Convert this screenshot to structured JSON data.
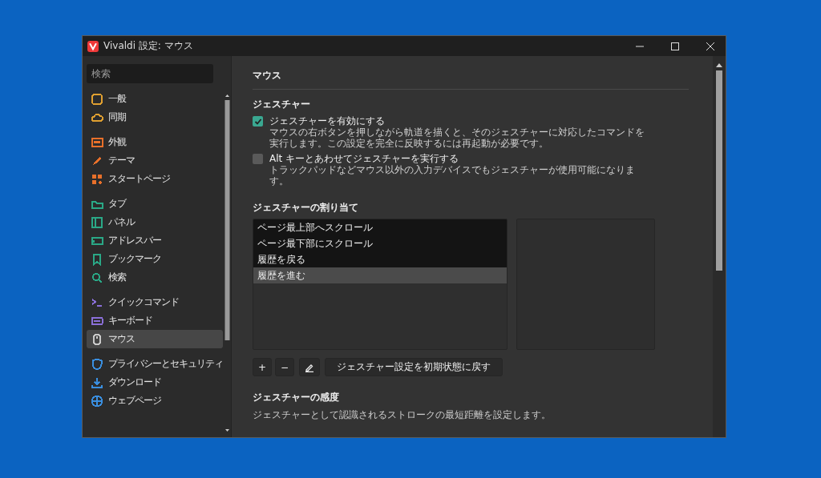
{
  "window": {
    "title": "Vivaldi 設定: マウス"
  },
  "sidebar": {
    "search": {
      "placeholder": "検索"
    },
    "groups": [
      [
        {
          "label": "一般",
          "color": "#e0a030",
          "selected": false
        },
        {
          "label": "同期",
          "color": "#e0a030",
          "selected": false
        }
      ],
      [
        {
          "label": "外観",
          "color": "#e8702a",
          "selected": false
        },
        {
          "label": "テーマ",
          "color": "#e8702a",
          "selected": false
        },
        {
          "label": "スタートページ",
          "color": "#e8702a",
          "selected": false
        }
      ],
      [
        {
          "label": "タブ",
          "color": "#2aa886",
          "selected": false
        },
        {
          "label": "パネル",
          "color": "#2aa886",
          "selected": false
        },
        {
          "label": "アドレスバー",
          "color": "#2aa886",
          "selected": false
        },
        {
          "label": "ブックマーク",
          "color": "#2aa886",
          "selected": false
        },
        {
          "label": "検索",
          "color": "#2aa886",
          "selected": false
        }
      ],
      [
        {
          "label": "クイックコマンド",
          "color": "#8a6fd8",
          "selected": false
        },
        {
          "label": "キーボード",
          "color": "#8a6fd8",
          "selected": false
        },
        {
          "label": "マウス",
          "color": "#c8c8c8",
          "selected": true
        }
      ],
      [
        {
          "label": "プライバシーとセキュリティ",
          "color": "#3a8fe0",
          "selected": false
        },
        {
          "label": "ダウンロード",
          "color": "#3a8fe0",
          "selected": false
        },
        {
          "label": "ウェブページ",
          "color": "#3a8fe0",
          "selected": false
        }
      ]
    ]
  },
  "page": {
    "title": "マウス",
    "gestures": {
      "title": "ジェスチャー",
      "options": [
        {
          "label": "ジェスチャーを有効にする",
          "description": "マウスの右ボタンを押しながら軌道を描くと、そのジェスチャーに対応したコマンドを実行します。この設定を完全に反映するには再起動が必要です。",
          "checked": true
        },
        {
          "label": "Alt キーとあわせてジェスチャーを実行する",
          "description": "トラックパッドなどマウス以外の入力デバイスでもジェスチャーが使用可能になります。",
          "checked": false
        }
      ]
    },
    "assignments": {
      "title": "ジェスチャーの割り当て",
      "items": [
        {
          "label": "ページ最上部へスクロール",
          "selected": false
        },
        {
          "label": "ページ最下部にスクロール",
          "selected": false
        },
        {
          "label": "履歴を戻る",
          "selected": false
        },
        {
          "label": "履歴を進む",
          "selected": true
        }
      ],
      "buttons": [
        {
          "kind": "add",
          "label": "+"
        },
        {
          "kind": "remove",
          "label": "−"
        },
        {
          "kind": "edit"
        },
        {
          "kind": "reset",
          "label": "ジェスチャー設定を初期状態に戻す"
        }
      ]
    },
    "sensitivity": {
      "title": "ジェスチャーの感度",
      "description": "ジェスチャーとして認識されるストロークの最短距離を設定します。"
    }
  }
}
